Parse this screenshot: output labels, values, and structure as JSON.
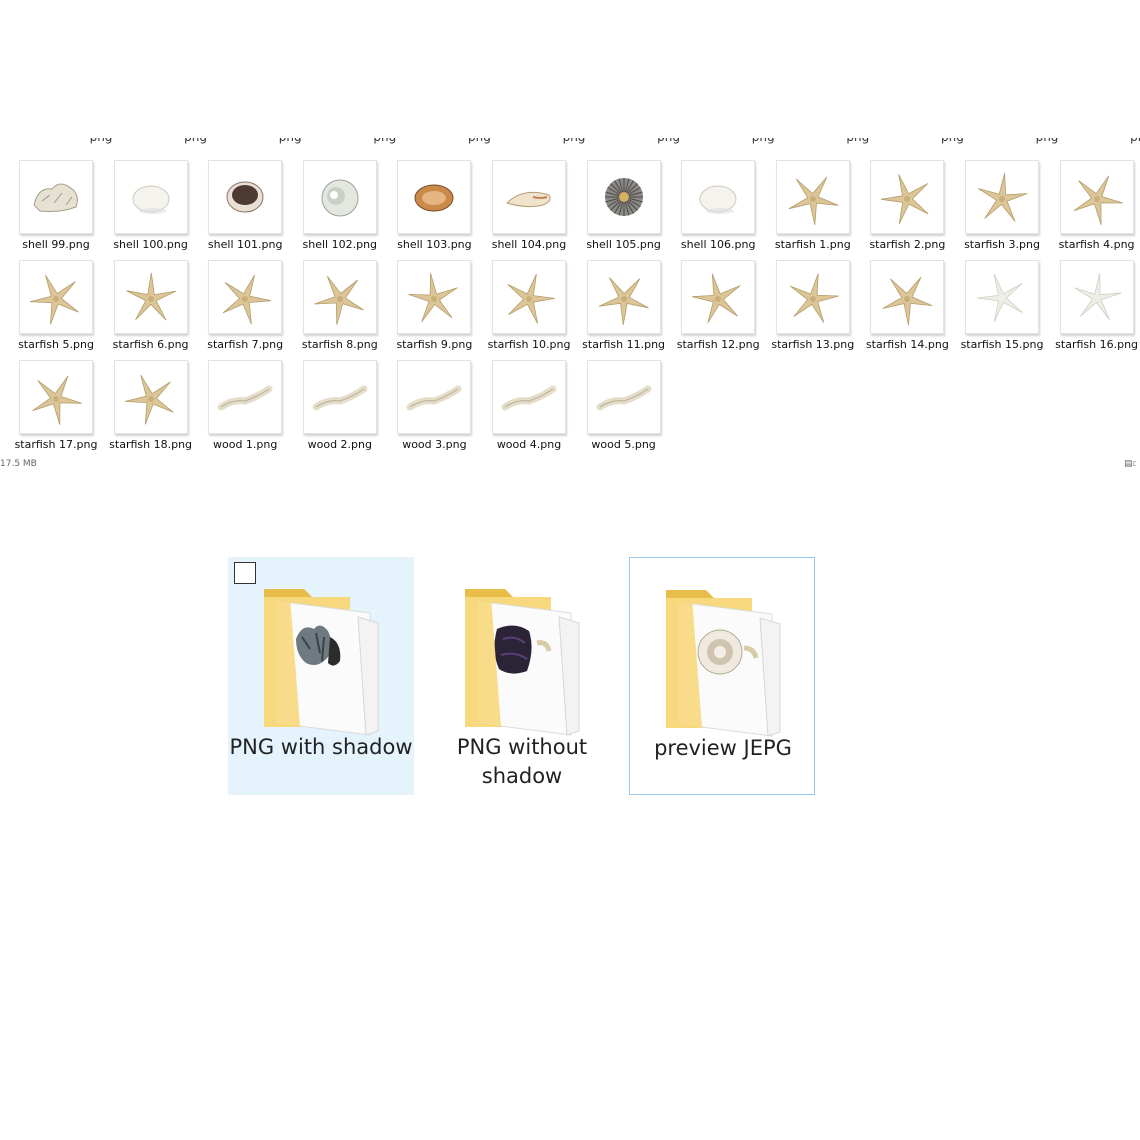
{
  "explorer": {
    "files": [
      {
        "name": "shell 99.png",
        "kind": "shell-coral-icon"
      },
      {
        "name": "shell 100.png",
        "kind": "shell-white-icon"
      },
      {
        "name": "shell 101.png",
        "kind": "shell-dark-icon"
      },
      {
        "name": "shell 102.png",
        "kind": "shell-spiral-icon"
      },
      {
        "name": "shell 103.png",
        "kind": "shell-cowrie-icon"
      },
      {
        "name": "shell 104.png",
        "kind": "shell-conch-icon"
      },
      {
        "name": "shell 105.png",
        "kind": "shell-urchin-icon"
      },
      {
        "name": "shell 106.png",
        "kind": "shell-white-icon"
      },
      {
        "name": "starfish 1.png",
        "kind": "starfish-icon"
      },
      {
        "name": "starfish 2.png",
        "kind": "starfish-icon"
      },
      {
        "name": "starfish 3.png",
        "kind": "starfish-icon"
      },
      {
        "name": "starfish 4.png",
        "kind": "starfish-icon"
      },
      {
        "name": "starfish 5.png",
        "kind": "starfish-icon"
      },
      {
        "name": "starfish 6.png",
        "kind": "starfish-icon"
      },
      {
        "name": "starfish 7.png",
        "kind": "starfish-icon"
      },
      {
        "name": "starfish 8.png",
        "kind": "starfish-icon"
      },
      {
        "name": "starfish 9.png",
        "kind": "starfish-icon"
      },
      {
        "name": "starfish 10.png",
        "kind": "starfish-icon"
      },
      {
        "name": "starfish 11.png",
        "kind": "starfish-icon"
      },
      {
        "name": "starfish 12.png",
        "kind": "starfish-icon"
      },
      {
        "name": "starfish 13.png",
        "kind": "starfish-icon"
      },
      {
        "name": "starfish 14.png",
        "kind": "starfish-icon"
      },
      {
        "name": "starfish 15.png",
        "kind": "starfish-white-icon"
      },
      {
        "name": "starfish 16.png",
        "kind": "starfish-white-icon"
      },
      {
        "name": "starfish 17.png",
        "kind": "starfish-icon"
      },
      {
        "name": "starfish 18.png",
        "kind": "starfish-icon"
      },
      {
        "name": "wood 1.png",
        "kind": "driftwood-icon"
      },
      {
        "name": "wood 2.png",
        "kind": "driftwood-icon"
      },
      {
        "name": "wood 3.png",
        "kind": "driftwood-icon"
      },
      {
        "name": "wood 4.png",
        "kind": "driftwood-icon"
      },
      {
        "name": "wood 5.png",
        "kind": "driftwood-icon"
      }
    ],
    "status_size": "17.5 MB"
  },
  "folders": [
    {
      "label": "PNG with shadow",
      "selected": true,
      "focused": false,
      "preview": "coral-icon"
    },
    {
      "label": "PNG without shadow",
      "selected": false,
      "focused": false,
      "preview": "dark-shell-icon"
    },
    {
      "label": "preview JEPG",
      "selected": false,
      "focused": true,
      "preview": "urchin-shell-icon"
    }
  ],
  "colors": {
    "folder_yellow": "#f7d87c",
    "folder_dark": "#e8bd4a",
    "selection_bg": "#e5f3fd",
    "focus_border": "#99c9ef",
    "starfish": "#dcc698"
  }
}
